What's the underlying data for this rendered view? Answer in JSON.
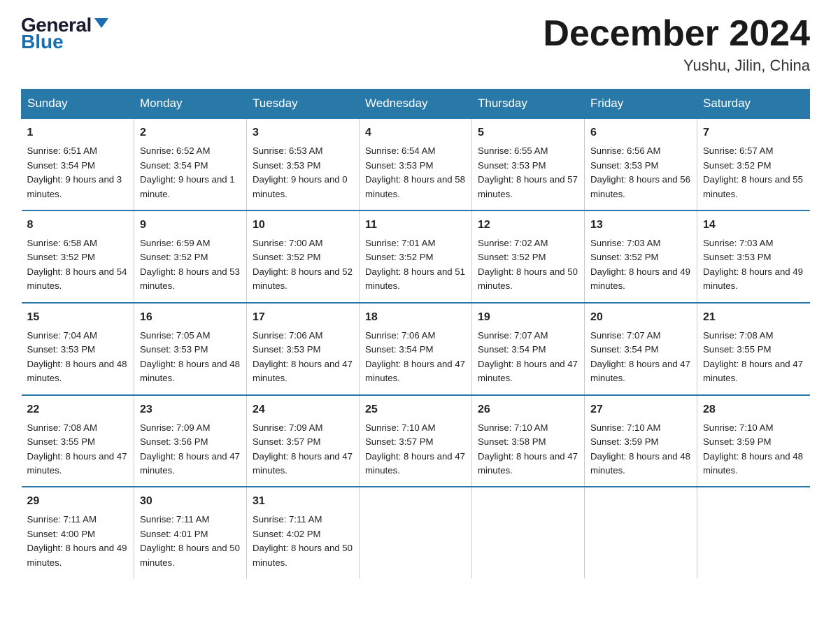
{
  "header": {
    "logo_general": "General",
    "logo_blue": "Blue",
    "month_year": "December 2024",
    "location": "Yushu, Jilin, China"
  },
  "days_of_week": [
    "Sunday",
    "Monday",
    "Tuesday",
    "Wednesday",
    "Thursday",
    "Friday",
    "Saturday"
  ],
  "weeks": [
    [
      {
        "day": "1",
        "sunrise": "6:51 AM",
        "sunset": "3:54 PM",
        "daylight": "9 hours and 3 minutes."
      },
      {
        "day": "2",
        "sunrise": "6:52 AM",
        "sunset": "3:54 PM",
        "daylight": "9 hours and 1 minute."
      },
      {
        "day": "3",
        "sunrise": "6:53 AM",
        "sunset": "3:53 PM",
        "daylight": "9 hours and 0 minutes."
      },
      {
        "day": "4",
        "sunrise": "6:54 AM",
        "sunset": "3:53 PM",
        "daylight": "8 hours and 58 minutes."
      },
      {
        "day": "5",
        "sunrise": "6:55 AM",
        "sunset": "3:53 PM",
        "daylight": "8 hours and 57 minutes."
      },
      {
        "day": "6",
        "sunrise": "6:56 AM",
        "sunset": "3:53 PM",
        "daylight": "8 hours and 56 minutes."
      },
      {
        "day": "7",
        "sunrise": "6:57 AM",
        "sunset": "3:52 PM",
        "daylight": "8 hours and 55 minutes."
      }
    ],
    [
      {
        "day": "8",
        "sunrise": "6:58 AM",
        "sunset": "3:52 PM",
        "daylight": "8 hours and 54 minutes."
      },
      {
        "day": "9",
        "sunrise": "6:59 AM",
        "sunset": "3:52 PM",
        "daylight": "8 hours and 53 minutes."
      },
      {
        "day": "10",
        "sunrise": "7:00 AM",
        "sunset": "3:52 PM",
        "daylight": "8 hours and 52 minutes."
      },
      {
        "day": "11",
        "sunrise": "7:01 AM",
        "sunset": "3:52 PM",
        "daylight": "8 hours and 51 minutes."
      },
      {
        "day": "12",
        "sunrise": "7:02 AM",
        "sunset": "3:52 PM",
        "daylight": "8 hours and 50 minutes."
      },
      {
        "day": "13",
        "sunrise": "7:03 AM",
        "sunset": "3:52 PM",
        "daylight": "8 hours and 49 minutes."
      },
      {
        "day": "14",
        "sunrise": "7:03 AM",
        "sunset": "3:53 PM",
        "daylight": "8 hours and 49 minutes."
      }
    ],
    [
      {
        "day": "15",
        "sunrise": "7:04 AM",
        "sunset": "3:53 PM",
        "daylight": "8 hours and 48 minutes."
      },
      {
        "day": "16",
        "sunrise": "7:05 AM",
        "sunset": "3:53 PM",
        "daylight": "8 hours and 48 minutes."
      },
      {
        "day": "17",
        "sunrise": "7:06 AM",
        "sunset": "3:53 PM",
        "daylight": "8 hours and 47 minutes."
      },
      {
        "day": "18",
        "sunrise": "7:06 AM",
        "sunset": "3:54 PM",
        "daylight": "8 hours and 47 minutes."
      },
      {
        "day": "19",
        "sunrise": "7:07 AM",
        "sunset": "3:54 PM",
        "daylight": "8 hours and 47 minutes."
      },
      {
        "day": "20",
        "sunrise": "7:07 AM",
        "sunset": "3:54 PM",
        "daylight": "8 hours and 47 minutes."
      },
      {
        "day": "21",
        "sunrise": "7:08 AM",
        "sunset": "3:55 PM",
        "daylight": "8 hours and 47 minutes."
      }
    ],
    [
      {
        "day": "22",
        "sunrise": "7:08 AM",
        "sunset": "3:55 PM",
        "daylight": "8 hours and 47 minutes."
      },
      {
        "day": "23",
        "sunrise": "7:09 AM",
        "sunset": "3:56 PM",
        "daylight": "8 hours and 47 minutes."
      },
      {
        "day": "24",
        "sunrise": "7:09 AM",
        "sunset": "3:57 PM",
        "daylight": "8 hours and 47 minutes."
      },
      {
        "day": "25",
        "sunrise": "7:10 AM",
        "sunset": "3:57 PM",
        "daylight": "8 hours and 47 minutes."
      },
      {
        "day": "26",
        "sunrise": "7:10 AM",
        "sunset": "3:58 PM",
        "daylight": "8 hours and 47 minutes."
      },
      {
        "day": "27",
        "sunrise": "7:10 AM",
        "sunset": "3:59 PM",
        "daylight": "8 hours and 48 minutes."
      },
      {
        "day": "28",
        "sunrise": "7:10 AM",
        "sunset": "3:59 PM",
        "daylight": "8 hours and 48 minutes."
      }
    ],
    [
      {
        "day": "29",
        "sunrise": "7:11 AM",
        "sunset": "4:00 PM",
        "daylight": "8 hours and 49 minutes."
      },
      {
        "day": "30",
        "sunrise": "7:11 AM",
        "sunset": "4:01 PM",
        "daylight": "8 hours and 50 minutes."
      },
      {
        "day": "31",
        "sunrise": "7:11 AM",
        "sunset": "4:02 PM",
        "daylight": "8 hours and 50 minutes."
      },
      {
        "day": "",
        "sunrise": "",
        "sunset": "",
        "daylight": ""
      },
      {
        "day": "",
        "sunrise": "",
        "sunset": "",
        "daylight": ""
      },
      {
        "day": "",
        "sunrise": "",
        "sunset": "",
        "daylight": ""
      },
      {
        "day": "",
        "sunrise": "",
        "sunset": "",
        "daylight": ""
      }
    ]
  ]
}
